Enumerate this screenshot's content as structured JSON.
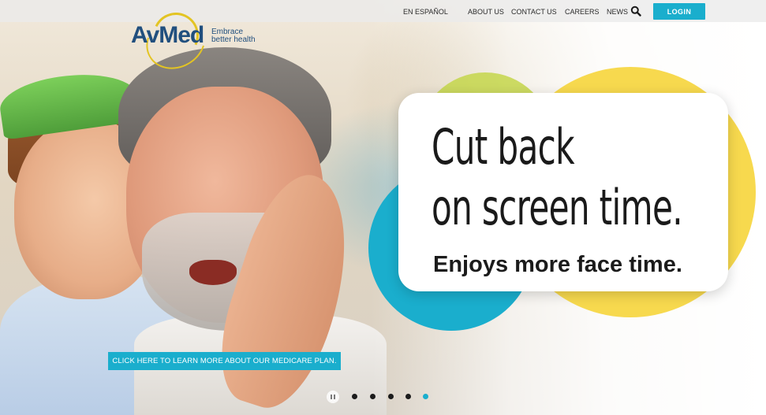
{
  "nav": {
    "links": [
      {
        "label": "EN ESPAÑOL"
      },
      {
        "label": "ABOUT US"
      },
      {
        "label": "CONTACT US"
      },
      {
        "label": "CAREERS"
      },
      {
        "label": "NEWS"
      }
    ],
    "search_icon": "search-icon",
    "login_label": "LOGIN"
  },
  "logo": {
    "wordmark": "AvMed",
    "tagline_line1": "Embrace",
    "tagline_line2": "better health"
  },
  "hero": {
    "headline_line1": "Cut back",
    "headline_line2": "on screen time.",
    "subline": "Enjoys more face time.",
    "cta_label": "CLICK HERE TO LEARN MORE ABOUT OUR MEDICARE PLAN."
  },
  "carousel": {
    "slide_count": 5,
    "active_index": 4,
    "pause_icon": "pause-icon"
  },
  "colors": {
    "accent_blue": "#1aaecd",
    "yellow": "#f7d94e",
    "lime": "#c4d64a",
    "logo_navy": "#214f7e",
    "logo_gold": "#e3c423"
  }
}
